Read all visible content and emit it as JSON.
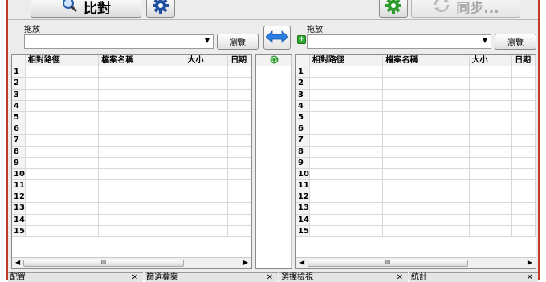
{
  "toolbar": {
    "compare_label": "比對",
    "sync_label": "同步...",
    "icons": [
      "search-magnifier-icon",
      "gear-icon",
      "gear-green-icon",
      "sync-icon"
    ]
  },
  "left_path": {
    "label": "拖放",
    "value": "",
    "browse_label": "瀏覽"
  },
  "right_path": {
    "label": "拖放",
    "value": "",
    "browse_label": "瀏覽"
  },
  "table": {
    "columns": [
      "相對路徑",
      "檔案名稱",
      "大小",
      "日期"
    ],
    "rows": [
      "1",
      "2",
      "3",
      "4",
      "5",
      "6",
      "7",
      "8",
      "9",
      "10",
      "11",
      "12",
      "13",
      "14",
      "15"
    ]
  },
  "scroll_label": "III",
  "bottom_panels": [
    {
      "title": "配置"
    },
    {
      "title": "篩選檔案"
    },
    {
      "title": "選擇檢視"
    },
    {
      "title": "統計"
    }
  ],
  "colors": {
    "accent_border": "#c0392b",
    "gear_blue": "#1f4fa0",
    "gear_green": "#2e9b2e",
    "swap_blue": "#2a7de1"
  }
}
